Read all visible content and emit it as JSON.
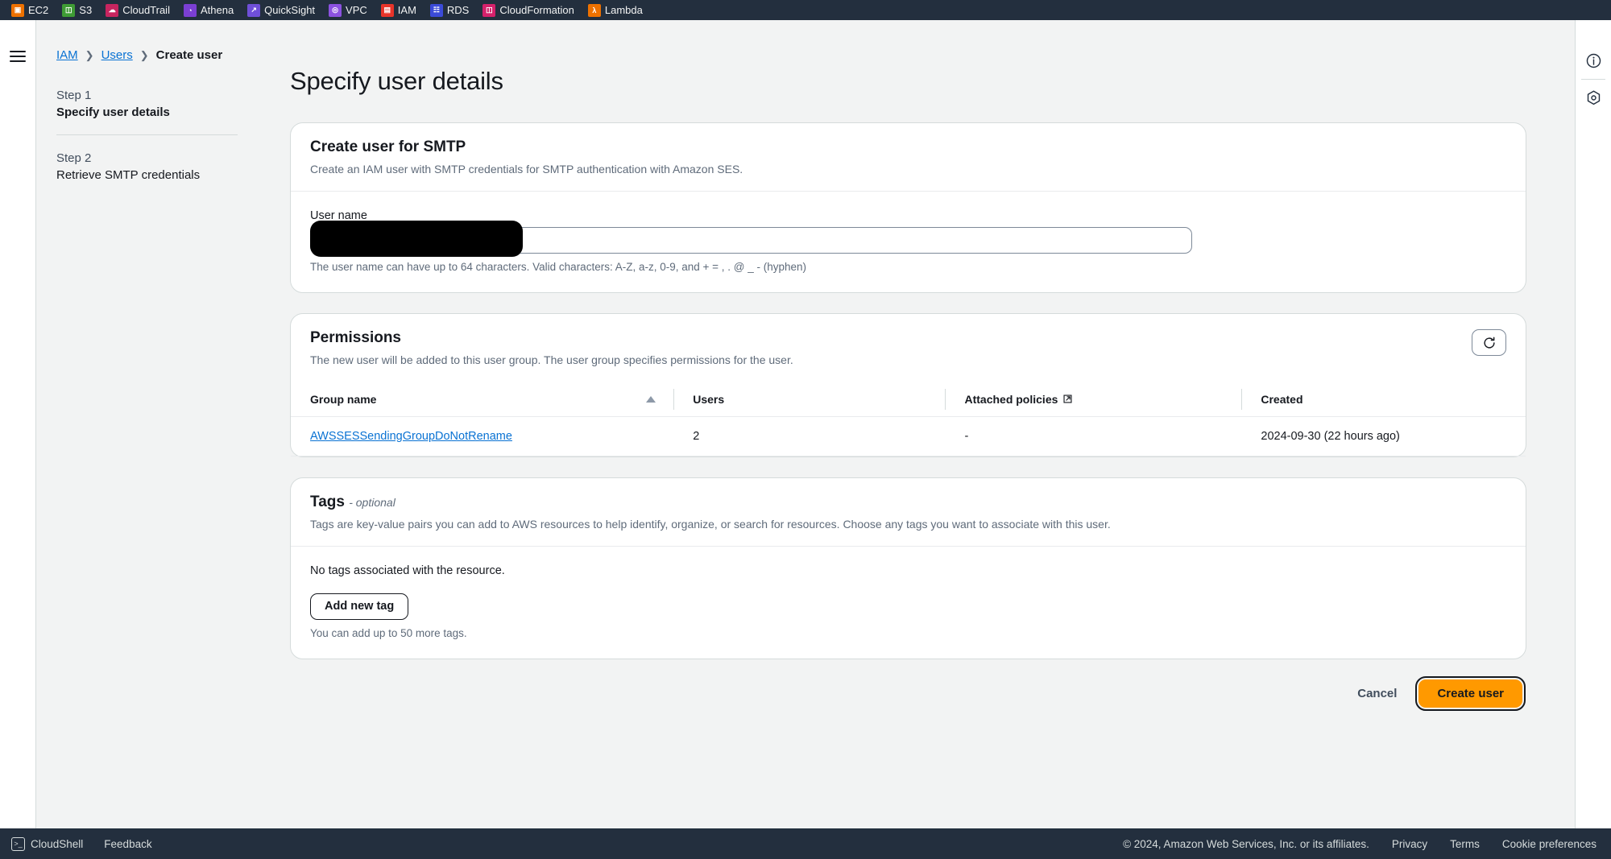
{
  "bookmarks": [
    {
      "label": "EC2",
      "icon": "ec2-icon",
      "color": "#ed7100",
      "glyph": "❐"
    },
    {
      "label": "S3",
      "icon": "s3-icon",
      "color": "#3f9c35",
      "glyph": "⛃"
    },
    {
      "label": "CloudTrail",
      "icon": "cloudtrail-icon",
      "color": "#c7255f",
      "glyph": "☁"
    },
    {
      "label": "Athena",
      "icon": "athena-icon",
      "color": "#7b3fd4",
      "glyph": "◔"
    },
    {
      "label": "QuickSight",
      "icon": "quicksight-icon",
      "color": "#6f4fd8",
      "glyph": "↗"
    },
    {
      "label": "VPC",
      "icon": "vpc-icon",
      "color": "#8c52e0",
      "glyph": "◎"
    },
    {
      "label": "IAM",
      "icon": "iam-icon",
      "color": "#e8342a",
      "glyph": "▤"
    },
    {
      "label": "RDS",
      "icon": "rds-icon",
      "color": "#3b4bd8",
      "glyph": "☷"
    },
    {
      "label": "CloudFormation",
      "icon": "cloudformation-icon",
      "color": "#d5216b",
      "glyph": "◫"
    },
    {
      "label": "Lambda",
      "icon": "lambda-icon",
      "color": "#ed7100",
      "glyph": "λ"
    }
  ],
  "breadcrumb": {
    "iam": "IAM",
    "users": "Users",
    "current": "Create user",
    "separator": "❯"
  },
  "wizard": {
    "step1_num": "Step 1",
    "step1_name": "Specify user details",
    "step2_num": "Step 2",
    "step2_name": "Retrieve SMTP credentials"
  },
  "page": {
    "title": "Specify user details"
  },
  "smtp_panel": {
    "title": "Create user for SMTP",
    "description": "Create an IAM user with SMTP credentials for SMTP authentication with Amazon SES.",
    "username_label": "User name",
    "username_value": "",
    "username_placeholder": "",
    "username_hint": "The user name can have up to 64 characters. Valid characters: A-Z, a-z, 0-9, and + = , . @ _ - (hyphen)"
  },
  "permissions_panel": {
    "title": "Permissions",
    "description": "The new user will be added to this user group. The user group specifies permissions for the user.",
    "refresh_icon": "refresh-icon",
    "columns": [
      {
        "label": "Group name",
        "sorted": "ascending"
      },
      {
        "label": "Users",
        "sorted": ""
      },
      {
        "label": "Attached policies",
        "sorted": "",
        "external": true
      },
      {
        "label": "Created",
        "sorted": ""
      }
    ],
    "rows": [
      {
        "group_name": "AWSSESSendingGroupDoNotRename",
        "users": "2",
        "attached_policies": "-",
        "created": "2024-09-30 (22 hours ago)"
      }
    ]
  },
  "tags_panel": {
    "title": "Tags",
    "optional_suffix": "- optional",
    "description": "Tags are key-value pairs you can add to AWS resources to help identify, organize, or search for resources. Choose any tags you want to associate with this user.",
    "empty_text": "No tags associated with the resource.",
    "add_button": "Add new tag",
    "limit_hint": "You can add up to 50 more tags."
  },
  "actions": {
    "cancel": "Cancel",
    "create": "Create user",
    "primary_color": "#ff9900"
  },
  "right_rail": [
    {
      "icon": "info-icon"
    },
    {
      "icon": "settings-hex-icon"
    }
  ],
  "statusbar": {
    "cloudshell": "CloudShell",
    "feedback": "Feedback",
    "copyright": "© 2024, Amazon Web Services, Inc. or its affiliates.",
    "privacy": "Privacy",
    "terms": "Terms",
    "cookies": "Cookie preferences"
  }
}
